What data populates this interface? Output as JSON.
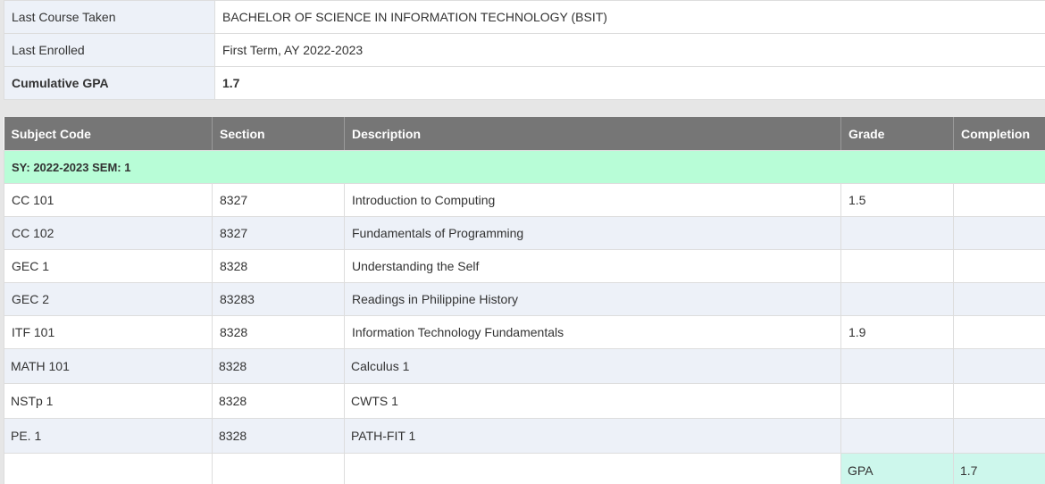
{
  "info": {
    "rows": [
      {
        "label": "Last Course Taken",
        "value": "BACHELOR OF SCIENCE IN INFORMATION TECHNOLOGY (BSIT)"
      },
      {
        "label": "Last Enrolled",
        "value": "First Term, AY 2022-2023"
      },
      {
        "label": "Cumulative GPA",
        "value": "1.7"
      }
    ]
  },
  "grades": {
    "headers": {
      "subject_code": "Subject Code",
      "section": "Section",
      "description": "Description",
      "grade": "Grade",
      "completion": "Completion"
    },
    "semester_label": "SY: 2022-2023 SEM: 1",
    "rows": [
      {
        "code": "CC 101",
        "section": "8327",
        "description": "Introduction to Computing",
        "grade": "1.5",
        "completion": ""
      },
      {
        "code": "CC 102",
        "section": "8327",
        "description": "Fundamentals of Programming",
        "grade": "",
        "completion": ""
      },
      {
        "code": "GEC 1",
        "section": "8328",
        "description": "Understanding the Self",
        "grade": "",
        "completion": ""
      },
      {
        "code": "GEC 2",
        "section": "83283",
        "description": "Readings in Philippine History",
        "grade": "",
        "completion": ""
      },
      {
        "code": "ITF 101",
        "section": "8328",
        "description": "Information Technology Fundamentals",
        "grade": "1.9",
        "completion": ""
      },
      {
        "code": "MATH 101",
        "section": "8328",
        "description": "Calculus 1",
        "grade": "",
        "completion": ""
      },
      {
        "code": "NSTp 1",
        "section": "8328",
        "description": "CWTS 1",
        "grade": "",
        "completion": ""
      },
      {
        "code": "PE. 1",
        "section": "8328",
        "description": "PATH-FIT 1",
        "grade": "",
        "completion": ""
      }
    ],
    "footer": {
      "gpa_label": "GPA",
      "gpa_value": "1.7"
    }
  },
  "colors": {
    "header_bg": "#767676",
    "semester_bg": "#b8fdd7",
    "alt_row_bg": "#edf1f8",
    "gpa_bg": "#cdf7ec"
  }
}
